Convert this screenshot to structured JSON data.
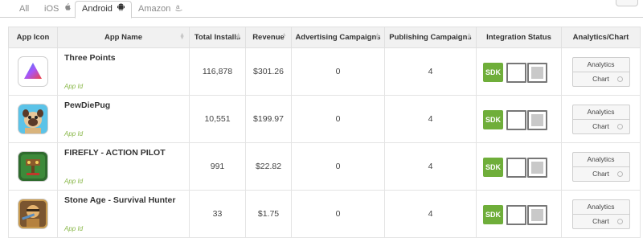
{
  "tabs": [
    {
      "label": "All",
      "icon": ""
    },
    {
      "label": "iOS",
      "icon": "apple-icon"
    },
    {
      "label": "Android",
      "icon": "android-icon"
    },
    {
      "label": "Amazon",
      "icon": "amazon-icon"
    }
  ],
  "table": {
    "headers": [
      "App Icon",
      "App Name",
      "Total Installs",
      "Revenue",
      "Advertising Campaigns",
      "Publishing Campaigns",
      "Integration Status",
      "Analytics/Chart"
    ],
    "rows": [
      {
        "name": "Three Points",
        "app_id": "App Id",
        "installs": "116,878",
        "revenue": "$301.26",
        "ad_campaigns": "0",
        "pub_campaigns": "4",
        "sdk": "SDK",
        "analytics": "Analytics",
        "chart": "Chart"
      },
      {
        "name": "PewDiePug",
        "app_id": "App Id",
        "installs": "10,551",
        "revenue": "$199.97",
        "ad_campaigns": "0",
        "pub_campaigns": "4",
        "sdk": "SDK",
        "analytics": "Analytics",
        "chart": "Chart"
      },
      {
        "name": "FIREFLY - ACTION PILOT",
        "app_id": "App Id",
        "installs": "991",
        "revenue": "$22.82",
        "ad_campaigns": "0",
        "pub_campaigns": "4",
        "sdk": "SDK",
        "analytics": "Analytics",
        "chart": "Chart"
      },
      {
        "name": "Stone Age - Survival Hunter",
        "app_id": "App Id",
        "installs": "33",
        "revenue": "$1.75",
        "ad_campaigns": "0",
        "pub_campaigns": "4",
        "sdk": "SDK",
        "analytics": "Analytics",
        "chart": "Chart"
      }
    ]
  },
  "colors": {
    "sdk_green": "#6fae3a",
    "app_id_green": "#8ab84a",
    "header_bg": "#f1f1f1"
  }
}
